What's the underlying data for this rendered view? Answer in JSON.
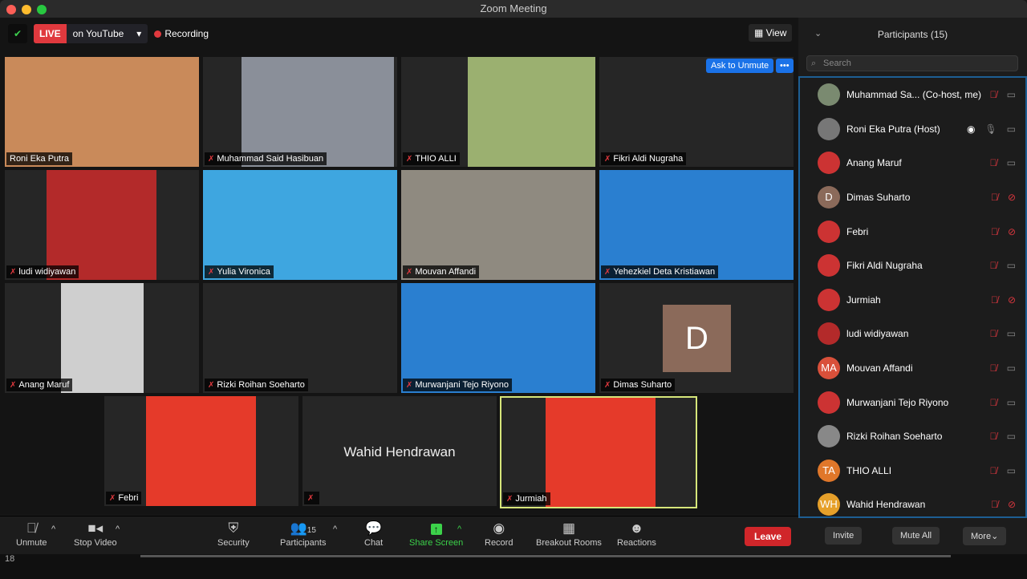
{
  "window": {
    "title": "Zoom Meeting"
  },
  "topbar": {
    "live": "LIVE",
    "live_target": "on YouTube",
    "recording": "Recording",
    "view": "View"
  },
  "ask_unmute": "Ask to Unmute",
  "more_dots": "•••",
  "tiles": [
    {
      "name": "Roni Eka Putra",
      "muted": false,
      "bg": "#c98a5a"
    },
    {
      "name": "Muhammad Said Hasibuan",
      "muted": true,
      "bg": "#8a8f99"
    },
    {
      "name": "THIO ALLI",
      "muted": true,
      "bg": "#9bb070"
    },
    {
      "name": "Fikri Aldi Nugraha",
      "muted": true,
      "bg": "#262626"
    },
    {
      "name": "ludi widiyawan",
      "muted": true,
      "bg": "#b32a2a"
    },
    {
      "name": "Yulia Vironica",
      "muted": true,
      "bg": "#3ea6e0"
    },
    {
      "name": "Mouvan Affandi",
      "muted": true,
      "bg": "#8f8a80"
    },
    {
      "name": "Yehezkiel Deta Kristiawan",
      "muted": true,
      "bg": "#2a7fd0"
    },
    {
      "name": "Anang Maruf",
      "muted": true,
      "bg": "#cfcfcf"
    },
    {
      "name": "Rizki Roihan Soeharto",
      "muted": true,
      "bg": "#262626"
    },
    {
      "name": "Murwanjani Tejo Riyono",
      "muted": true,
      "bg": "#2a7fd0"
    },
    {
      "name": "Dimas Suharto",
      "muted": true,
      "bg": "#262626",
      "avatar": "D"
    },
    {
      "name": "Febri",
      "muted": true,
      "bg": "#e53a2a"
    },
    {
      "name": "",
      "muted": true,
      "bg": "#262626",
      "center_name": "Wahid Hendrawan"
    },
    {
      "name": "Jurmiah",
      "muted": true,
      "bg": "#e53a2a"
    }
  ],
  "toolbar": {
    "unmute": "Unmute",
    "stop_video": "Stop Video",
    "security": "Security",
    "participants": "Participants",
    "participants_count": "15",
    "chat": "Chat",
    "share_screen": "Share Screen",
    "record": "Record",
    "breakout": "Breakout Rooms",
    "reactions": "Reactions",
    "leave": "Leave"
  },
  "sidebar": {
    "title": "Participants (15)",
    "search_placeholder": "Search",
    "invite": "Invite",
    "mute_all": "Mute All",
    "more": "More",
    "participants": [
      {
        "name": "Muhammad Sa... (Co-host, me)",
        "initials": "",
        "color": "#7a8a70",
        "mic": "muted",
        "video": "on"
      },
      {
        "name": "Roni Eka Putra (Host)",
        "initials": "",
        "color": "#777",
        "mic": "on",
        "video": "on",
        "recording": true
      },
      {
        "name": "Anang Maruf",
        "initials": "",
        "color": "#c33",
        "mic": "muted",
        "video": "on"
      },
      {
        "name": "Dimas Suharto",
        "initials": "D",
        "color": "#8b6a5a",
        "mic": "muted",
        "video": "off"
      },
      {
        "name": "Febri",
        "initials": "",
        "color": "#c33",
        "mic": "muted",
        "video": "off"
      },
      {
        "name": "Fikri Aldi Nugraha",
        "initials": "",
        "color": "#c33",
        "mic": "muted",
        "video": "on"
      },
      {
        "name": "Jurmiah",
        "initials": "",
        "color": "#c33",
        "mic": "muted",
        "video": "off"
      },
      {
        "name": "ludi widiyawan",
        "initials": "",
        "color": "#b32a2a",
        "mic": "muted",
        "video": "on"
      },
      {
        "name": "Mouvan Affandi",
        "initials": "MA",
        "color": "#d9503a",
        "mic": "muted",
        "video": "on"
      },
      {
        "name": "Murwanjani Tejo Riyono",
        "initials": "",
        "color": "#c33",
        "mic": "muted",
        "video": "on"
      },
      {
        "name": "Rizki Roihan Soeharto",
        "initials": "",
        "color": "#888",
        "mic": "muted",
        "video": "on"
      },
      {
        "name": "THIO ALLI",
        "initials": "TA",
        "color": "#e0772a",
        "mic": "muted",
        "video": "on"
      },
      {
        "name": "Wahid Hendrawan",
        "initials": "WH",
        "color": "#e6a02a",
        "mic": "muted",
        "video": "off"
      }
    ]
  },
  "taskbar": {
    "text": "18"
  }
}
